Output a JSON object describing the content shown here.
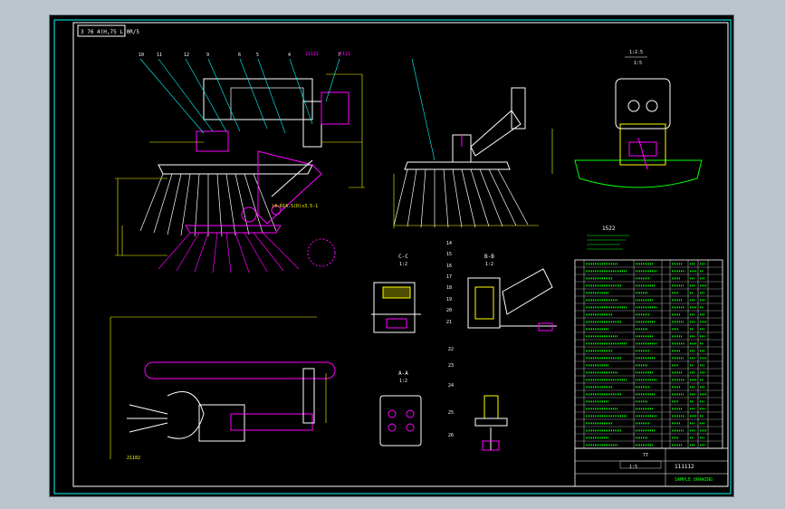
{
  "drawing": {
    "title_box": "3 76 4(H,75 L)0R/5",
    "section_cc": "C-C",
    "section_bb": "B-B",
    "section_aa": "A-A",
    "scale_cc": "1:2",
    "scale_bb": "1:2",
    "scale_aa": "1:2",
    "view_label": "1:5",
    "top_note": "1:2.5",
    "part_callouts": [
      "10",
      "11",
      "12",
      "9",
      "6",
      "5",
      "4",
      "7",
      "8",
      "3",
      "2",
      "1"
    ],
    "side_callouts": [
      "14",
      "15",
      "16",
      "17",
      "18",
      "19",
      "20",
      "21",
      "22",
      "23",
      "24",
      "25",
      "26"
    ],
    "dimension_label": "1522",
    "dim_notes": [
      "21102",
      "1000",
      "(4-R14.5(D)x3.5-1",
      "370",
      "42"
    ],
    "title_block": {
      "drawing_name": "SAMPLE DRAWING",
      "drawing_number": "111112",
      "scale_note": "1:5",
      "sheet": "77"
    }
  },
  "colors": {
    "background": "#000000",
    "frame": "#00ffff",
    "outline": "#ffffff",
    "part": "#ff00ff",
    "dimension": "#ffff00",
    "leader": "#00ffff",
    "bom": "#00ff00"
  }
}
